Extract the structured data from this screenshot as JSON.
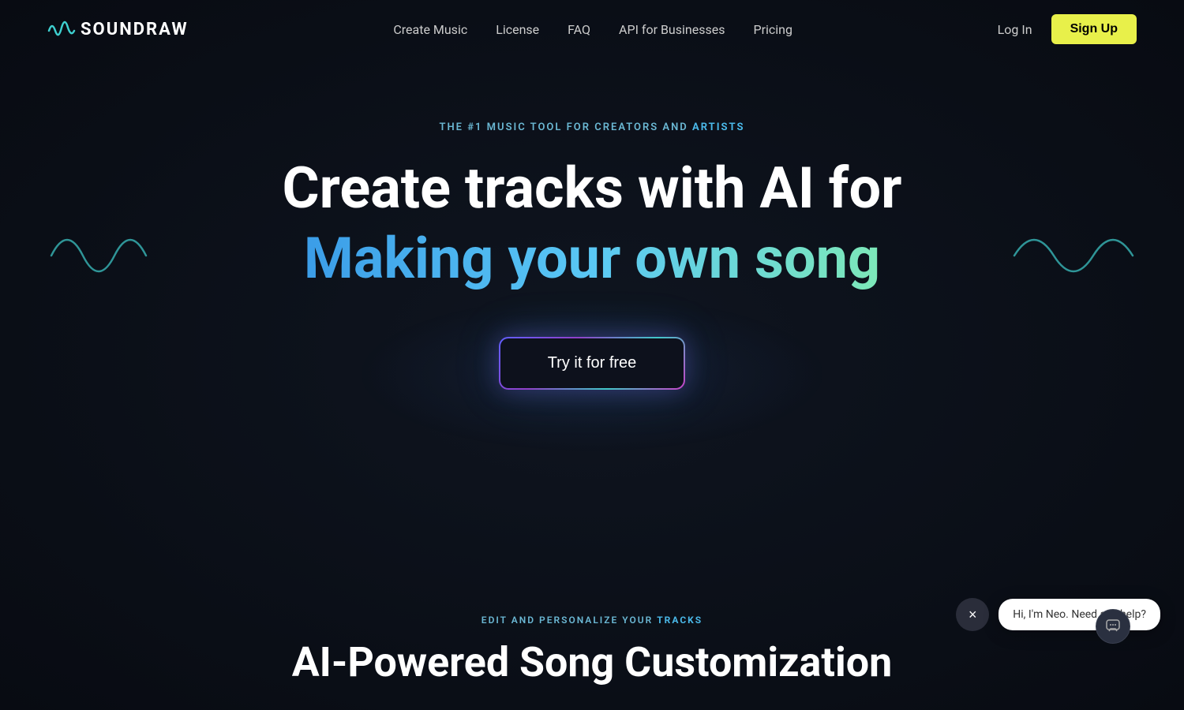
{
  "navbar": {
    "logo_icon": "〰",
    "logo_text": "SOUNDRAW",
    "nav_links": [
      {
        "label": "Create Music",
        "id": "create-music"
      },
      {
        "label": "License",
        "id": "license"
      },
      {
        "label": "FAQ",
        "id": "faq"
      },
      {
        "label": "API for Businesses",
        "id": "api"
      },
      {
        "label": "Pricing",
        "id": "pricing"
      }
    ],
    "login_label": "Log In",
    "signup_label": "Sign Up"
  },
  "hero": {
    "badge_part1": "THE #1 MUSIC TOOL FOR CREATORS AND ",
    "badge_highlight": "ARTISTS",
    "title_line1": "Create tracks with AI for",
    "title_line2": "Making your own song",
    "cta_label": "Try it for free"
  },
  "bottom": {
    "badge_text": "EDIT AND PERSONALIZE YOUR TRACKS",
    "title": "AI-Powered Song Customization"
  },
  "chat": {
    "message": "Hi, I'm Neo. Need any help?",
    "close_icon": "×"
  },
  "colors": {
    "accent_yellow": "#e8f04a",
    "accent_blue": "#4ab8e8",
    "accent_teal": "#3ecfcf",
    "text_primary": "#ffffff",
    "bg_dark": "#0a0d14"
  }
}
